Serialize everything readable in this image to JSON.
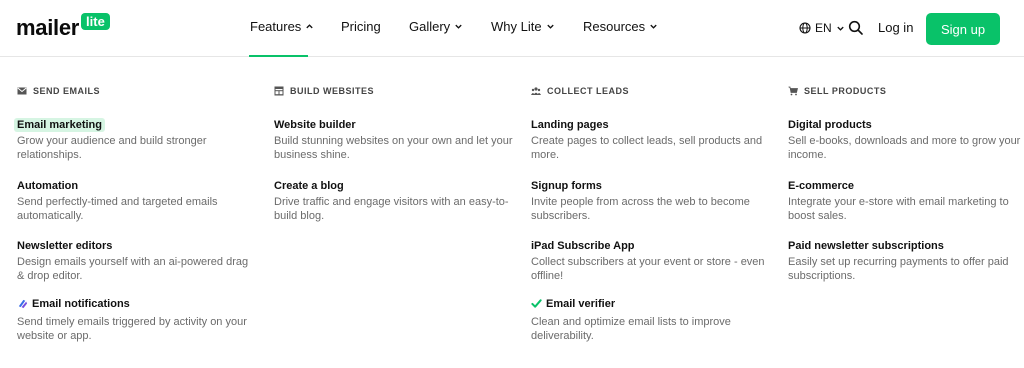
{
  "brand": {
    "word": "mailer",
    "badge": "lite",
    "accent": "#09c269"
  },
  "nav": {
    "features": "Features",
    "pricing": "Pricing",
    "gallery": "Gallery",
    "why_lite": "Why Lite",
    "resources": "Resources"
  },
  "header_right": {
    "lang": "EN",
    "login": "Log in",
    "signup": "Sign up"
  },
  "columns": [
    {
      "heading": "SEND EMAILS",
      "icon": "envelope-icon",
      "items": [
        {
          "title": "Email marketing",
          "desc": "Grow your audience and build stronger relationships."
        },
        {
          "title": "Automation",
          "desc": "Send perfectly-timed and targeted emails automatically."
        },
        {
          "title": "Newsletter editors",
          "desc": "Design emails yourself with an ai-powered drag & drop editor."
        },
        {
          "title": "Email notifications",
          "desc": "Send timely emails triggered by activity on your website or app."
        }
      ]
    },
    {
      "heading": "BUILD WEBSITES",
      "icon": "website-icon",
      "items": [
        {
          "title": "Website builder",
          "desc": "Build stunning websites on your own and let your business shine."
        },
        {
          "title": "Create a blog",
          "desc": "Drive traffic and engage visitors with an easy-to-build blog."
        }
      ]
    },
    {
      "heading": "COLLECT LEADS",
      "icon": "people-icon",
      "items": [
        {
          "title": "Landing pages",
          "desc": "Create pages to collect leads, sell products and more."
        },
        {
          "title": "Signup forms",
          "desc": "Invite people from across the web to become subscribers."
        },
        {
          "title": "iPad Subscribe App",
          "desc": "Collect subscribers at your event or store - even offline!"
        },
        {
          "title": "Email verifier",
          "desc": "Clean and optimize email lists to improve deliverability."
        }
      ]
    },
    {
      "heading": "SELL PRODUCTS",
      "icon": "cart-icon",
      "items": [
        {
          "title": "Digital products",
          "desc": "Sell e-books, downloads and more to grow your income."
        },
        {
          "title": "E-commerce",
          "desc": "Integrate your e-store with email marketing to boost sales."
        },
        {
          "title": "Paid newsletter subscriptions",
          "desc": "Easily set up recurring payments to offer paid subscriptions."
        }
      ]
    }
  ]
}
